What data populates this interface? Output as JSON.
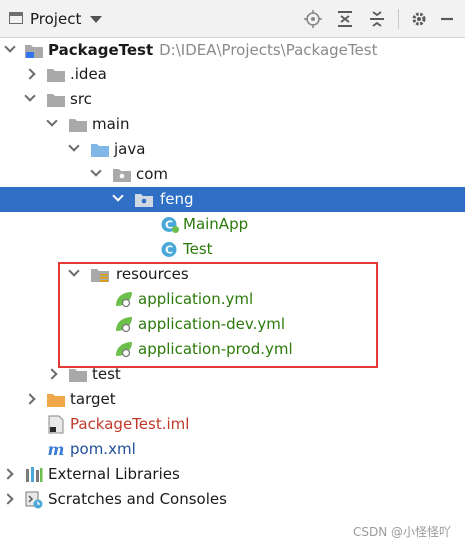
{
  "toolbar": {
    "title": "Project",
    "icons": [
      "locate-icon",
      "expand-all-icon",
      "collapse-all-icon",
      "settings-gear-icon",
      "hide-minus-icon"
    ]
  },
  "tree": {
    "root": {
      "name": "PackageTest",
      "path": "D:\\IDEA\\Projects\\PackageTest"
    },
    "idea": ".idea",
    "src": "src",
    "main": "main",
    "java": "java",
    "com": "com",
    "feng": "feng",
    "mainapp": "MainApp",
    "test_class": "Test",
    "resources": "resources",
    "app_yml": "application.yml",
    "app_dev_yml": "application-dev.yml",
    "app_prod_yml": "application-prod.yml",
    "test_dir": "test",
    "target": "target",
    "iml": "PackageTest.iml",
    "pom": "pom.xml",
    "external_libs": "External Libraries",
    "scratches": "Scratches and Consoles"
  },
  "colors": {
    "selection": "#2f6fc5",
    "annotation_box": "#e53935",
    "folder_blue": "#7fb8e6",
    "folder_gray": "#a9a9a9",
    "folder_orange": "#f0a84b",
    "spring_green": "#6cbf4a"
  },
  "watermark": "CSDN @小怪怪吖"
}
